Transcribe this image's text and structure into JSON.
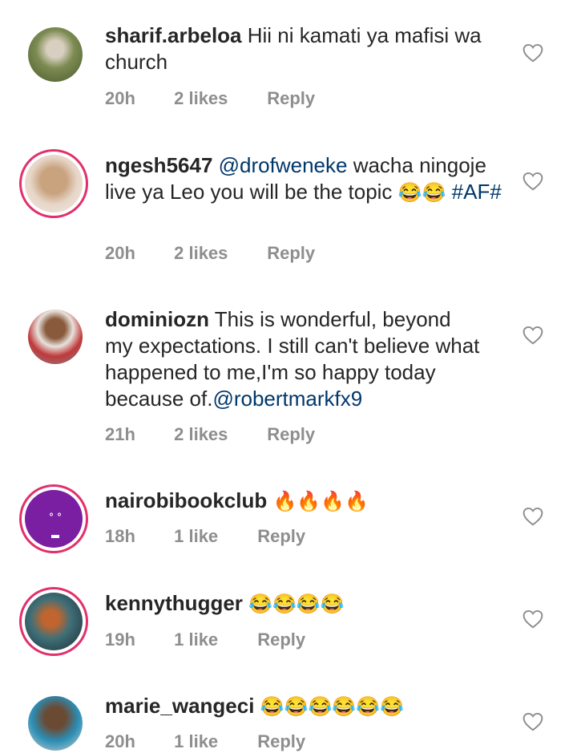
{
  "comments": [
    {
      "username": "sharif.arbeloa",
      "text": "Hii ni kamati ya mafisi wa church",
      "time": "20h",
      "likes": "2 likes",
      "reply": "Reply"
    },
    {
      "username": "ngesh5647",
      "mention": "@drofweneke",
      "text": "wacha ningoje live ya Leo you will be the topic",
      "emojis": "😂😂",
      "hashtag": "#AF#",
      "time": "20h",
      "likes": "2 likes",
      "reply": "Reply"
    },
    {
      "username": "dominiozn",
      "text": "This is wonderful, beyond my expectations. I still can't believe what happened to me,I'm so happy today because of.",
      "mention": "@robertmarkfx9",
      "time": "21h",
      "likes": "2 likes",
      "reply": "Reply"
    },
    {
      "username": "nairobibookclub",
      "emojis": "🔥🔥🔥🔥",
      "time": "18h",
      "likes": "1 like",
      "reply": "Reply"
    },
    {
      "username": "kennythugger",
      "emojis": "😂😂😂😂",
      "time": "19h",
      "likes": "1 like",
      "reply": "Reply"
    },
    {
      "username": "marie_wangeci",
      "emojis": "😂😂😂😂😂😂",
      "time": "20h",
      "likes": "1 like",
      "reply": "Reply"
    }
  ],
  "colors": {
    "mention": "#00376b",
    "meta": "#8e8e8e",
    "story_ring": "#e1306c"
  }
}
